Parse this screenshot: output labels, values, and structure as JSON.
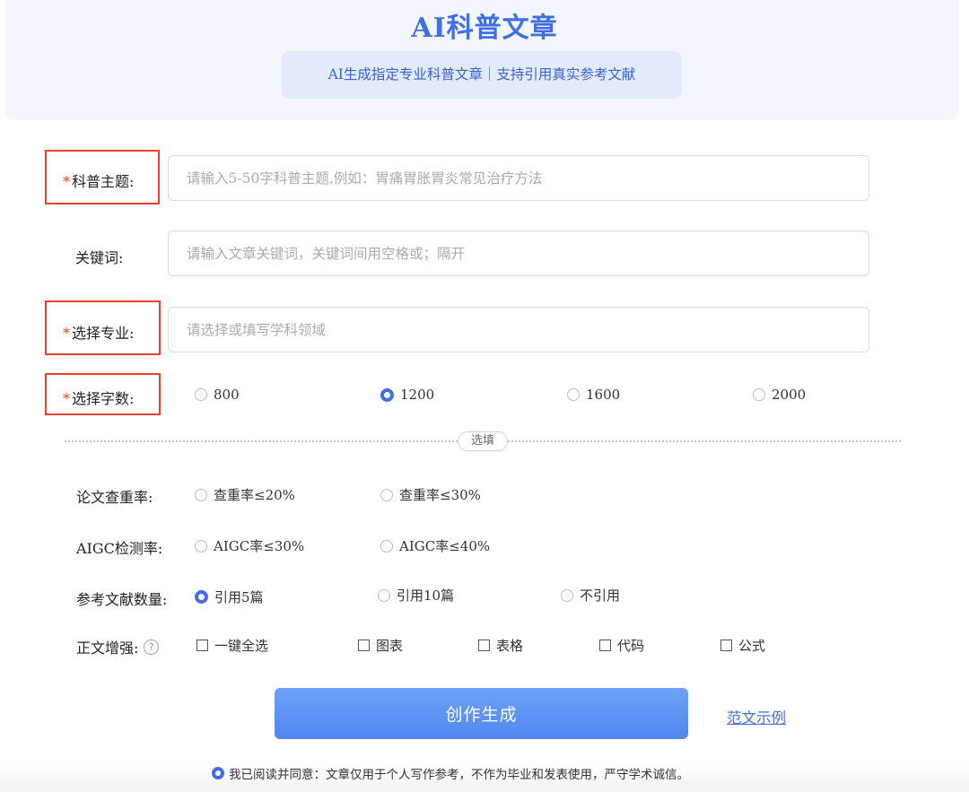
{
  "hero": {
    "title": "AI科普文章",
    "subtitle": "AI生成指定专业科普文章｜支持引用真实参考文献"
  },
  "form": {
    "topic": {
      "label": "科普主题:",
      "required": true,
      "placeholder": "请输入5-50字科普主题,例如：胃痛胃胀胃炎常见治疗方法",
      "value": ""
    },
    "keywords": {
      "label": "关键词:",
      "required": false,
      "placeholder": "请输入文章关键词，关键词间用空格或；隔开",
      "value": ""
    },
    "major": {
      "label": "选择专业:",
      "required": true,
      "placeholder": "请选择或填写学科领域",
      "value": ""
    },
    "word_count": {
      "label": "选择字数:",
      "required": true,
      "options": [
        "800",
        "1200",
        "1600",
        "2000"
      ],
      "selected": "1200"
    }
  },
  "divider_label": "选填",
  "optional": {
    "plagiarism": {
      "label": "论文查重率:",
      "options": [
        "查重率≤20%",
        "查重率≤30%"
      ],
      "selected": null
    },
    "aigc": {
      "label": "AIGC检测率:",
      "options": [
        "AIGC率≤30%",
        "AIGC率≤40%"
      ],
      "selected": null
    },
    "references": {
      "label": "参考文献数量:",
      "options": [
        "引用5篇",
        "引用10篇",
        "不引用"
      ],
      "selected": "引用5篇"
    },
    "enhance": {
      "label": "正文增强:",
      "help_icon": "question-circle-icon",
      "options": [
        "一键全选",
        "图表",
        "表格",
        "代码",
        "公式"
      ],
      "checked": []
    }
  },
  "actions": {
    "create_label": "创作生成",
    "sample_label": "范文示例"
  },
  "agreement": {
    "checked": true,
    "text": "我已阅读并同意：文章仅用于个人写作参考，不作为毕业和发表使用，严守学术诚信。"
  },
  "colors": {
    "accent": "#3f6fe8",
    "required_mark": "#e8412f",
    "hero_bg": "#f3f6fd",
    "button_gradient": [
      "#6fa3f7",
      "#4f86f0"
    ]
  }
}
